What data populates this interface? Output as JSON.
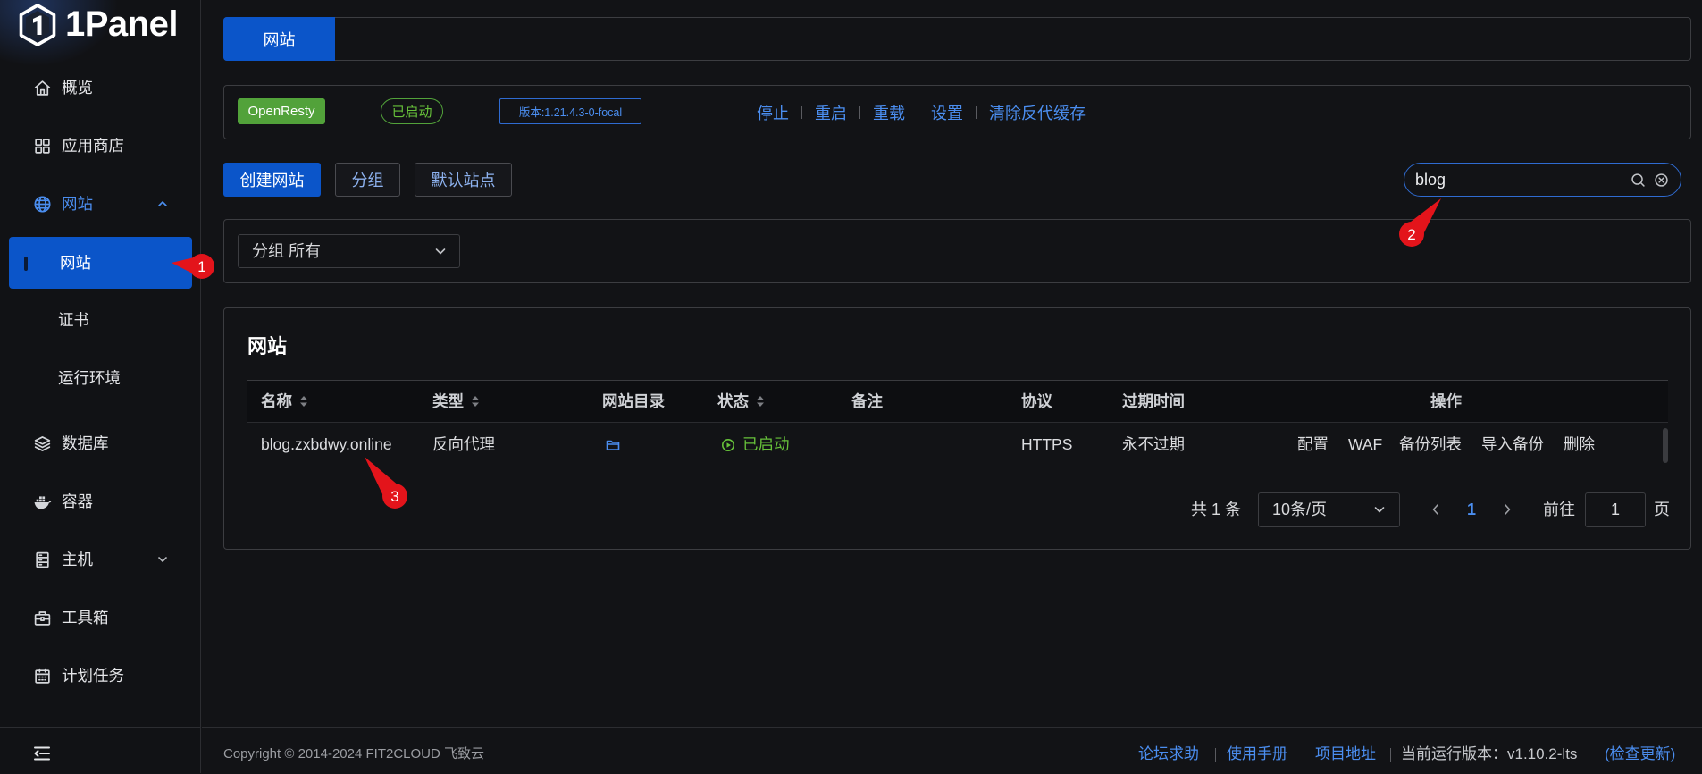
{
  "app": {
    "logo_text": "1Panel",
    "logo_icon": "1panel-logo-icon"
  },
  "sidebar": {
    "items": [
      {
        "label": "概览",
        "icon": "home-icon"
      },
      {
        "label": "应用商店",
        "icon": "apps-icon"
      },
      {
        "label": "网站",
        "icon": "globe-icon",
        "expanded": true,
        "children": [
          {
            "label": "网站",
            "active": true
          },
          {
            "label": "证书"
          },
          {
            "label": "运行环境"
          }
        ]
      },
      {
        "label": "数据库",
        "icon": "database-icon"
      },
      {
        "label": "容器",
        "icon": "docker-icon"
      },
      {
        "label": "主机",
        "icon": "host-icon",
        "expanded": false
      },
      {
        "label": "工具箱",
        "icon": "toolbox-icon"
      },
      {
        "label": "计划任务",
        "icon": "calendar-icon"
      }
    ],
    "collapse_icon": "menu-collapse-icon"
  },
  "tabs": [
    {
      "label": "网站",
      "active": true
    }
  ],
  "server": {
    "name": "OpenResty",
    "status": "已启动",
    "version": "版本:1.21.4.3-0-focal",
    "actions": [
      "停止",
      "重启",
      "重载",
      "设置",
      "清除反代缓存"
    ]
  },
  "toolbar": {
    "create_label": "创建网站",
    "group_label": "分组",
    "default_site_label": "默认站点",
    "search_value": "blog",
    "search_icon": "search-icon",
    "clear_icon": "clear-icon"
  },
  "filter": {
    "label": "分组",
    "value": "所有"
  },
  "table": {
    "title": "网站",
    "columns": [
      {
        "label": "名称",
        "sortable": true
      },
      {
        "label": "类型",
        "sortable": true
      },
      {
        "label": "网站目录",
        "sortable": false
      },
      {
        "label": "状态",
        "sortable": true
      },
      {
        "label": "备注",
        "sortable": false
      },
      {
        "label": "协议",
        "sortable": false
      },
      {
        "label": "过期时间",
        "sortable": false
      },
      {
        "label": "操作",
        "sortable": false
      }
    ],
    "rows": [
      {
        "name": "blog.zxbdwy.online",
        "type": "反向代理",
        "directory_icon": "folder-icon",
        "status": "已启动",
        "protocol": "HTTPS",
        "expire": "永不过期",
        "actions": [
          "配置",
          "WAF",
          "备份列表",
          "导入备份",
          "删除"
        ]
      }
    ]
  },
  "pagination": {
    "total": "共 1 条",
    "page_size": "10条/页",
    "current_page": "1",
    "goto_label": "前往",
    "goto_value": "1",
    "page_suffix": "页"
  },
  "footer": {
    "copyright": "Copyright © 2014-2024 FIT2CLOUD 飞致云",
    "links": [
      "论坛求助",
      "使用手册",
      "项目地址"
    ],
    "version": "当前运行版本：v1.10.2-lts",
    "check_update": "(检查更新)"
  },
  "annotations": [
    {
      "number": "1"
    },
    {
      "number": "2"
    },
    {
      "number": "3"
    }
  ],
  "colors": {
    "primary": "#0b55c9",
    "link": "#4b8ef0",
    "success": "#67c23a",
    "success_fill": "#52a23a",
    "annotation": "#e3141b",
    "background": "#121316"
  }
}
